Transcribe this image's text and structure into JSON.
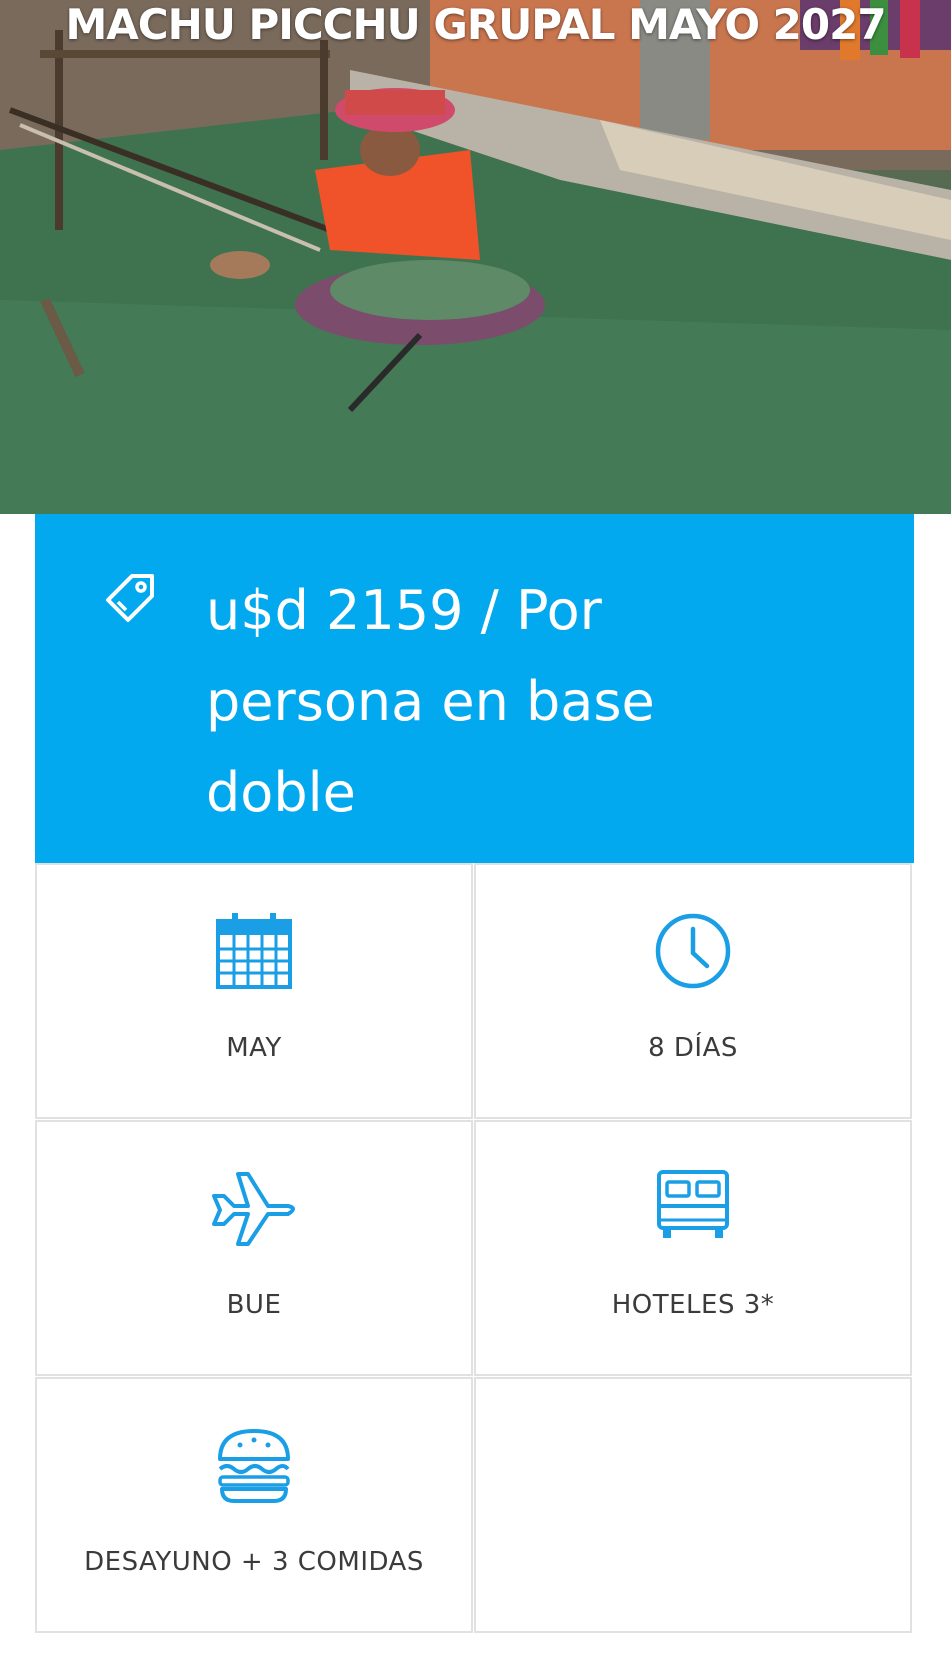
{
  "hero": {
    "title": "MACHU PICCHU GRUPAL MAYO 2027",
    "image_description_icon": "weaver-photo"
  },
  "price": {
    "icon": "price-tag-icon",
    "line1": "u$d 2159 / Por",
    "line2": "persona en base",
    "line3": "doble"
  },
  "features": [
    {
      "icon": "calendar-icon",
      "label": "MAY"
    },
    {
      "icon": "clock-icon",
      "label": "8 DÍAS"
    },
    {
      "icon": "airplane-icon",
      "label": "BUE"
    },
    {
      "icon": "bed-icon",
      "label": "HOTELES 3*"
    },
    {
      "icon": "burger-icon",
      "label": "DESAYUNO + 3 COMIDAS"
    }
  ],
  "colors": {
    "accent": "#03a9ee",
    "icon": "#1a9fe6",
    "border": "#e1e1e1",
    "text": "#3b3b3b"
  }
}
